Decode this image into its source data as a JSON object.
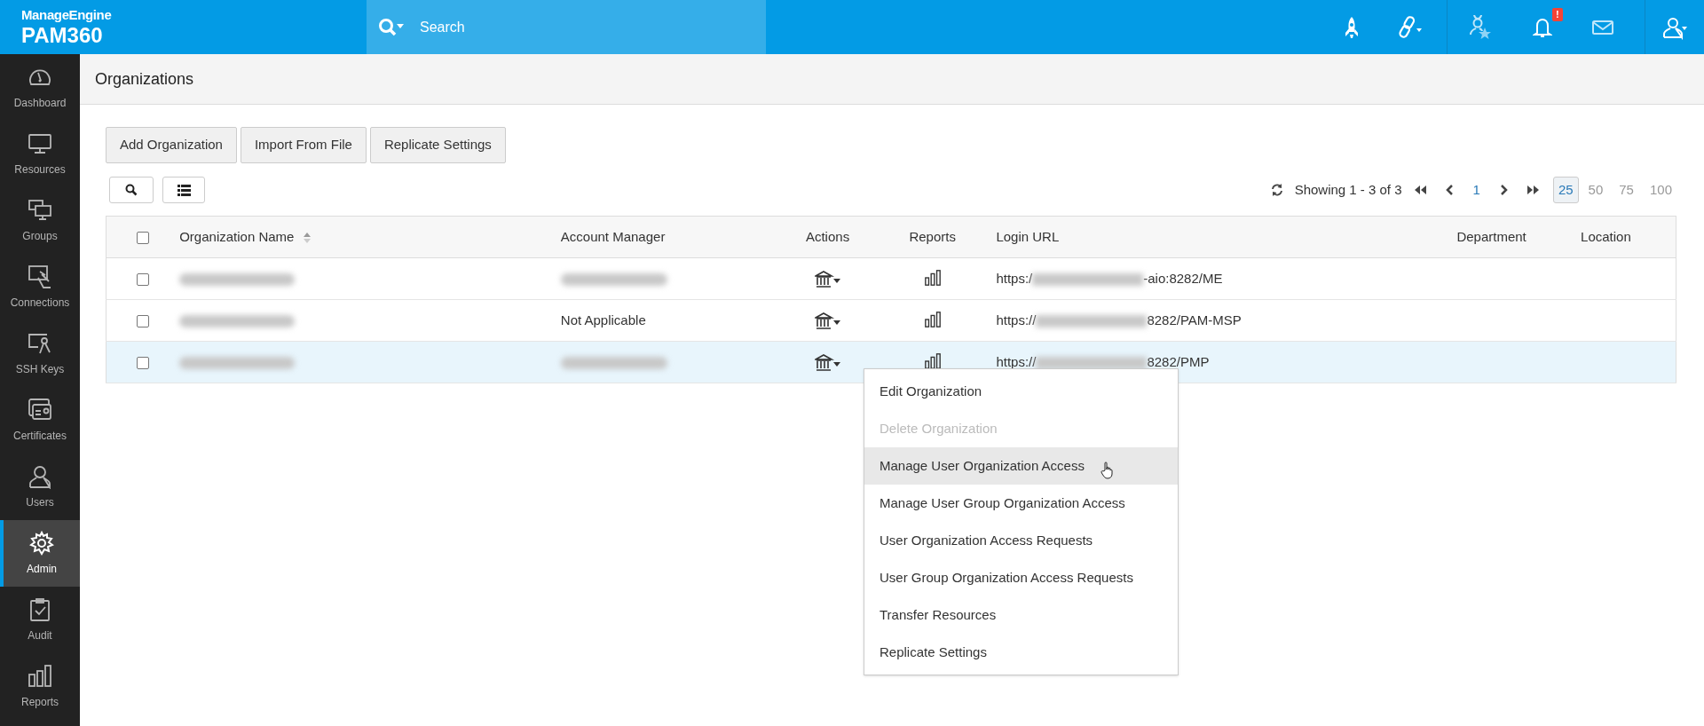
{
  "brand": {
    "vendor": "ManageEngine",
    "product": "PAM360"
  },
  "search": {
    "placeholder": "Search"
  },
  "notifications": {
    "alert": "!"
  },
  "sidebar": {
    "items": [
      {
        "label": "Dashboard",
        "kind": "gauge",
        "selected": false
      },
      {
        "label": "Resources",
        "kind": "monitor",
        "selected": false
      },
      {
        "label": "Groups",
        "kind": "monitors",
        "selected": false
      },
      {
        "label": "Connections",
        "kind": "connection",
        "selected": false
      },
      {
        "label": "SSH Keys",
        "kind": "keys",
        "selected": false
      },
      {
        "label": "Certificates",
        "kind": "certificate",
        "selected": false
      },
      {
        "label": "Users",
        "kind": "user",
        "selected": false
      },
      {
        "label": "Admin",
        "kind": "gear",
        "selected": true
      },
      {
        "label": "Audit",
        "kind": "clipboard",
        "selected": false
      },
      {
        "label": "Reports",
        "kind": "bars",
        "selected": false
      }
    ]
  },
  "page_title": "Organizations",
  "buttons": [
    "Add Organization",
    "Import From File",
    "Replicate Settings"
  ],
  "pagination": {
    "summary": "Showing 1 - 3 of 3",
    "page": "1",
    "page_sizes": [
      {
        "label": "25",
        "selected": true
      },
      {
        "label": "50",
        "selected": false
      },
      {
        "label": "75",
        "selected": false
      },
      {
        "label": "100",
        "selected": false
      }
    ]
  },
  "table": {
    "select_all_checked": false,
    "columns": [
      "Organization Name",
      "Account Manager",
      "Actions",
      "Reports",
      "Login URL",
      "Department",
      "Location"
    ],
    "rows": [
      {
        "checked": false,
        "selected": false,
        "url_prefix": "https:/",
        "url_suffix": "-aio:8282/ME"
      },
      {
        "checked": false,
        "selected": false,
        "account_manager": "Not Applicable",
        "url_prefix": "https://",
        "url_suffix": "8282/PAM-MSP"
      },
      {
        "checked": false,
        "selected": true,
        "url_prefix": "https://",
        "url_suffix": "8282/PMP"
      }
    ]
  },
  "actions_menu": {
    "items": [
      {
        "label": "Edit Organization",
        "disabled": false,
        "selected": false
      },
      {
        "label": "Delete Organization",
        "disabled": true,
        "selected": false
      },
      {
        "label": "Manage User Organization Access",
        "disabled": false,
        "selected": true
      },
      {
        "label": "Manage User Group Organization Access",
        "disabled": false,
        "selected": false
      },
      {
        "label": "User Organization Access Requests",
        "disabled": false,
        "selected": false
      },
      {
        "label": "User Group Organization Access Requests",
        "disabled": false,
        "selected": false
      },
      {
        "label": "Transfer Resources",
        "disabled": false,
        "selected": false
      },
      {
        "label": "Replicate Settings",
        "disabled": false,
        "selected": false
      }
    ]
  }
}
